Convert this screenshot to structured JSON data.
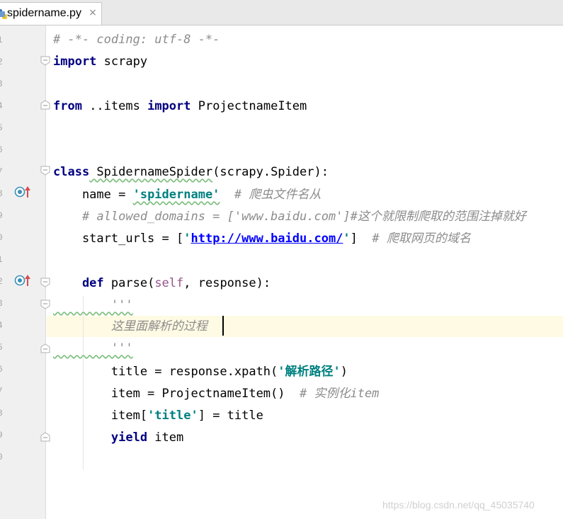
{
  "tab": {
    "title": "spidername.py",
    "close": "×"
  },
  "line_numbers": [
    "1",
    "2",
    "3",
    "4",
    "5",
    "6",
    "7",
    "8",
    "9",
    "0",
    "1",
    "2",
    "3",
    "4",
    "5",
    "6",
    "7",
    "8",
    "9",
    "0"
  ],
  "code": {
    "l1_comment": "# -*- coding: utf-8 -*-",
    "l2_kw": "import",
    "l2_rest": " scrapy",
    "l4_kw1": "from",
    "l4_mid": " ..items ",
    "l4_kw2": "import",
    "l4_rest": " ProjectnameItem",
    "l7_kw": "class",
    "l7_name": " SpidernameSpider",
    "l7_rest": "(scrapy.Spider):",
    "l8_pre": "    name = ",
    "l8_str": "'spidername'",
    "l8_comment": "  # 爬虫文件名从",
    "l9_comment": "    # allowed_domains = ['www.baidu.com']#这个就限制爬取的范围注掉就好",
    "l10_pre": "    start_urls = [",
    "l10_q1": "'",
    "l10_url": "http://www.baidu.com/",
    "l10_q2": "'",
    "l10_post": "]  ",
    "l10_comment": "# 爬取网页的域名",
    "l12_kw": "    def",
    "l12_name": " parse(",
    "l12_self": "self",
    "l12_rest": ", response):",
    "l13_doc": "        '''",
    "l14_doc": "        这里面解析的过程",
    "l15_doc": "        '''",
    "l16_pre": "        title = response.xpath(",
    "l16_str": "'解析路径'",
    "l16_post": ")",
    "l17_pre": "        item = ProjectnameItem()  ",
    "l17_comment": "# 实例化item",
    "l18_pre": "        item[",
    "l18_str": "'title'",
    "l18_post": "] = title",
    "l19_kw": "        yield",
    "l19_rest": " item"
  },
  "watermark": "https://blog.csdn.net/qq_45035740",
  "colors": {
    "keyword": "#000080",
    "string": "#008080",
    "comment": "#8c8c8c",
    "self": "#94558d",
    "link": "#0000ff",
    "caret_line": "#fffae3"
  }
}
